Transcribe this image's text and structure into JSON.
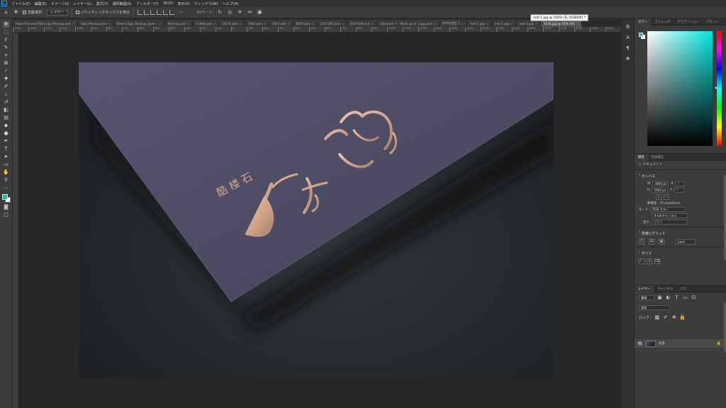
{
  "app": {
    "logo_text": "Ps"
  },
  "menu": [
    "ファイル(F)",
    "編集(E)",
    "イメージ(I)",
    "レイヤー(L)",
    "書式(Y)",
    "選択範囲(S)",
    "フィルター(T)",
    "3D(D)",
    "表示(V)",
    "ウィンドウ(W)",
    "ヘルプ(H)"
  ],
  "options": {
    "auto_select_label": "自動選択:",
    "auto_select_target": "レイヤー",
    "transform_controls_label": "バウンディングボックスを表示",
    "mode_3d_label": "3Dモード:"
  },
  "tabs": [
    {
      "label": "Paper-Pressed-PSD-Logo-Mockup.psd"
    },
    {
      "label": "Sign_Mockup.psd"
    },
    {
      "label": "Street_Sign_Mockup_Spot..."
    },
    {
      "label": "Mockup.psd"
    },
    {
      "label": "11849.psd"
    },
    {
      "label": "10076.psd"
    },
    {
      "label": "7642.psd"
    },
    {
      "label": "7643.psd"
    },
    {
      "label": "8097.psd"
    },
    {
      "label": "2347393.psd"
    },
    {
      "label": "2347400.psd"
    },
    {
      "label": "Collection 7 - Mock up 4 - Logo.psd"
    },
    {
      "label": "名称未設定 1"
    },
    {
      "label": "mdr-2.jpg"
    },
    {
      "label": "mdr-1.jpg"
    },
    {
      "label": "mdr-3.jpg"
    },
    {
      "label": "6545.jpg @ 50% (RG",
      "active": true
    }
  ],
  "tab_close_glyph": "×",
  "tab_tooltip": "mdr-1.jpg @ 100% (灰, RGB/8#) *",
  "ruler_h": [
    "1400",
    "1300",
    "1200",
    "1100",
    "1000",
    "900",
    "800",
    "700",
    "600",
    "500",
    "400",
    "300",
    "200",
    "100",
    "0",
    "100",
    "200",
    "300",
    "400",
    "500",
    "600",
    "700",
    "800",
    "900",
    "1000",
    "1100",
    "1200",
    "1300",
    "1400",
    "1500",
    "1600",
    "1700",
    "1800",
    "1900",
    "2000",
    "2100",
    "2200",
    "2300",
    "2400"
  ],
  "tools": [
    "move-tool-icon",
    "marquee-tool-icon",
    "lasso-tool-icon",
    "quick-select-tool-icon",
    "crop-tool-icon",
    "frame-tool-icon",
    "eyedropper-tool-icon",
    "healing-brush-tool-icon",
    "brush-tool-icon",
    "clone-stamp-tool-icon",
    "history-brush-tool-icon",
    "eraser-tool-icon",
    "gradient-tool-icon",
    "blur-tool-icon",
    "dodge-tool-icon",
    "pen-tool-icon",
    "type-tool-icon",
    "path-select-tool-icon",
    "rectangle-tool-icon",
    "hand-tool-icon",
    "zoom-tool-icon",
    "more-tools-icon"
  ],
  "artwork": {
    "logo_small": "酷 楼 石",
    "colors": {
      "paper": "#4a4762",
      "background": "#262a2c",
      "foil": "#d2a48b"
    }
  },
  "color_panel": {
    "tabs": [
      "カラー",
      "スウォッチ",
      "グラデーション",
      "パターン"
    ],
    "foreground": "#20b8b8",
    "background": "#ffffff"
  },
  "properties_panel": {
    "tabs": [
      "属性",
      "色調補正"
    ],
    "document_label": "ドキュメント",
    "canvas_heading": "カンバス",
    "width_label": "W",
    "width_value": "4800 px",
    "x_label": "X",
    "x_value": "0",
    "height_label": "H",
    "height_value": "3200 px",
    "y_label": "Y",
    "y_value": "0",
    "resolution_label": "解像度 : 72 pixel/inch",
    "mode_label": "モード",
    "mode_value": "RGB カラー",
    "bit_depth_value": "8 bit/チャンネル",
    "fill_label": "塗り",
    "fill_value": "背景色",
    "rulers_grid_heading": "定規とグリッド",
    "ruler_unit": "pixel",
    "guides_heading": "ガイド"
  },
  "layers_panel": {
    "tabs": [
      "レイヤー",
      "チャンネル",
      "パス"
    ],
    "filter_kind": "種類",
    "blend_mode": "通常",
    "lock_label": "ロック :",
    "layer_name": "背景"
  }
}
